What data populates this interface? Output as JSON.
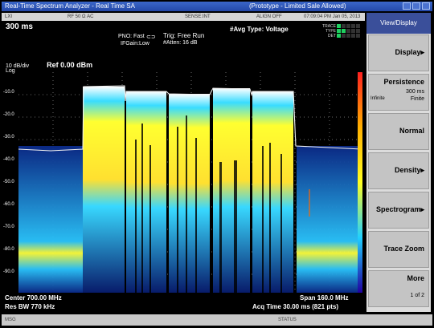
{
  "window": {
    "title": "Real-Time Spectrum Analyzer - Real Time SA",
    "status": "(Prototype - Limited Sale Allowed)"
  },
  "status_row": {
    "left": "LXI",
    "ref": "RF 50 Ω AC",
    "mode": "SENSE:INT",
    "align": "ALIGN OFF",
    "datetime": "07:09:04 PM Jan 05, 2013"
  },
  "header": {
    "acq_time": "300 ms",
    "pno": "PNO: Fast",
    "ifgain": "IFGain:Low",
    "trigger": "Trig: Free Run",
    "atten": "#Atten: 16 dB",
    "avg_type": "#Avg Type: Voltage",
    "trace_labels": [
      "TRACE",
      "TYPE",
      "DET"
    ],
    "trace_values": [
      "1 2 3 4 5 6",
      "W W W W W W",
      "P N N N N N"
    ]
  },
  "plot": {
    "scale": "10 dB/div",
    "scale_type": "Log",
    "ref": "Ref 0.00 dBm",
    "y_labels": [
      "-10.0",
      "-20.0",
      "-30.0",
      "-40.0",
      "-50.0",
      "-60.0",
      "-70.0",
      "-80.0",
      "-90.0"
    ]
  },
  "footer": {
    "center": "Center 700.00 MHz",
    "rbw": "Res BW 770 kHz",
    "span": "Span 160.0 MHz",
    "acq": "Acq Time  30.00 ms (821 pts)"
  },
  "sidebar": {
    "title": "View/Display",
    "keys": [
      {
        "main": "Display▸"
      },
      {
        "main": "Persistence",
        "sub": "300 ms",
        "sub2": "Finite",
        "subleft": "Infinite"
      },
      {
        "main": "Normal"
      },
      {
        "main": "Density▸"
      },
      {
        "main": "Spectrogram▸"
      },
      {
        "main": "Trace Zoom"
      },
      {
        "main": "More",
        "sub2": "1 of 2"
      }
    ]
  },
  "bottom_bar": {
    "msg": "MSG",
    "status": "STATUS"
  },
  "colors": {
    "plot_bg": "#000000",
    "cyan": "#35d8ff",
    "yellow": "#ffff33",
    "softkey_bg": "#c4c4c4"
  }
}
